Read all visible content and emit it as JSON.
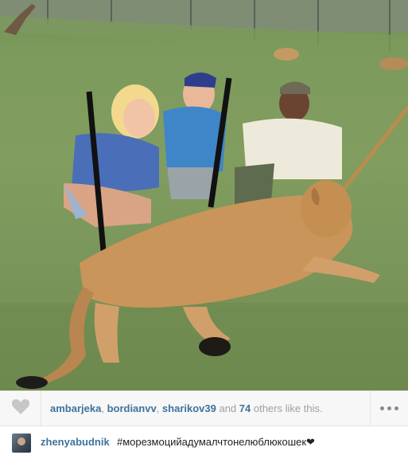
{
  "photo": {
    "description_icon": "photo"
  },
  "likes": {
    "liker_1": "ambarjeka",
    "sep_1": ", ",
    "liker_2": "bordianvv",
    "sep_2": ", ",
    "liker_3": "sharikov39",
    "and_text": " and ",
    "count": "74",
    "suffix": " others like this."
  },
  "caption": {
    "username": "zhenyabudnik",
    "text": "#морезмоцийадумалчтонелюблюкошек❤"
  },
  "colors": {
    "link": "#3f729b",
    "muted": "#a0a0a0",
    "bar": "#f7f7f7"
  },
  "icons": {
    "like": "heart-icon",
    "more": "ellipsis-icon"
  }
}
